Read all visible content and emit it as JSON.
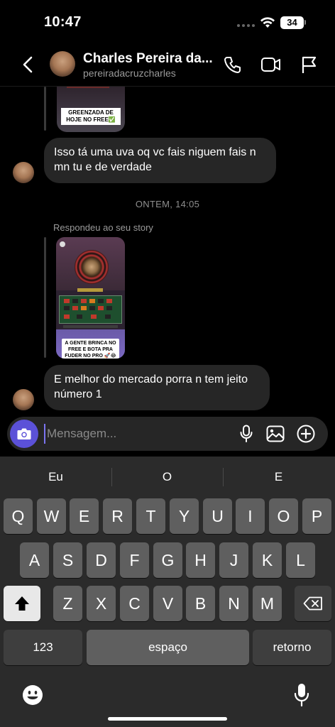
{
  "status_bar": {
    "time": "10:47",
    "battery": "34"
  },
  "header": {
    "contact_name": "Charles Pereira da...",
    "contact_handle": "pereiradacruzcharles",
    "icons": [
      "back-icon",
      "phone-icon",
      "video-icon",
      "flag-icon"
    ]
  },
  "chat": {
    "story_top_caption": "GREENZADA DE HOJE NO FREE✅",
    "messages": [
      {
        "text": "Isso tá uma uva oq vc fais niguem fais n mn tu e de verdade"
      },
      {
        "text": "E melhor do mercado porra n tem jeito número 1"
      }
    ],
    "timestamp": "ONTEM, 14:05",
    "reply_label": "Respondeu ao seu story",
    "story_caption": "A GENTE BRINCA NO FREE E BOTA PRA FUDER NO PRO 🚀😂"
  },
  "composer": {
    "placeholder": "Mensagem..."
  },
  "keyboard": {
    "suggestions": [
      "Eu",
      "O",
      "E"
    ],
    "row1": [
      "Q",
      "W",
      "E",
      "R",
      "T",
      "Y",
      "U",
      "I",
      "O",
      "P"
    ],
    "row2": [
      "A",
      "S",
      "D",
      "F",
      "G",
      "H",
      "J",
      "K",
      "L"
    ],
    "row3": [
      "Z",
      "X",
      "C",
      "V",
      "B",
      "N",
      "M"
    ],
    "numbers_label": "123",
    "space_label": "espaço",
    "return_label": "retorno"
  }
}
